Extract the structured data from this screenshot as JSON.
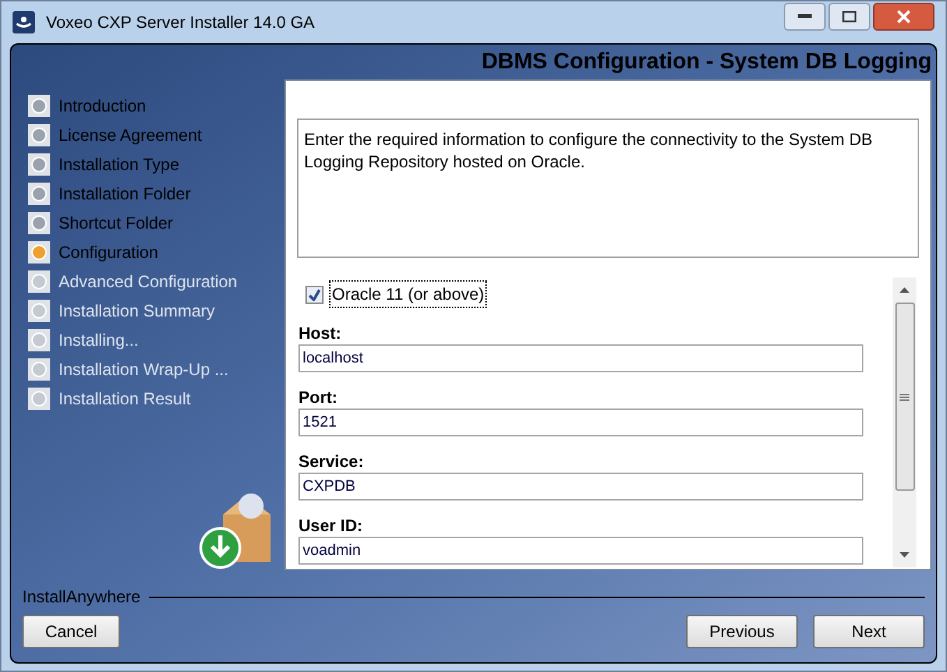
{
  "window": {
    "title": "Voxeo CXP Server Installer 14.0 GA"
  },
  "header": {
    "title": "DBMS Configuration - System DB Logging"
  },
  "steps": [
    {
      "label": "Introduction",
      "selected": false,
      "disabled": false
    },
    {
      "label": "License Agreement",
      "selected": false,
      "disabled": false
    },
    {
      "label": "Installation Type",
      "selected": false,
      "disabled": false
    },
    {
      "label": "Installation Folder",
      "selected": false,
      "disabled": false
    },
    {
      "label": "Shortcut Folder",
      "selected": false,
      "disabled": false
    },
    {
      "label": "Configuration",
      "selected": true,
      "disabled": false
    },
    {
      "label": "Advanced Configuration",
      "selected": false,
      "disabled": true
    },
    {
      "label": "Installation Summary",
      "selected": false,
      "disabled": true
    },
    {
      "label": "Installing...",
      "selected": false,
      "disabled": true
    },
    {
      "label": "Installation Wrap-Up ...",
      "selected": false,
      "disabled": true
    },
    {
      "label": "Installation Result",
      "selected": false,
      "disabled": true
    }
  ],
  "description": "Enter the required information to configure the connectivity to the System DB Logging Repository hosted on Oracle.",
  "oracle_checkbox": {
    "label": "Oracle 11 (or above)",
    "checked": true
  },
  "fields": [
    {
      "label": "Host:",
      "value": "localhost"
    },
    {
      "label": "Port:",
      "value": "1521"
    },
    {
      "label": "Service:",
      "value": "CXPDB"
    },
    {
      "label": "User ID:",
      "value": "voadmin"
    }
  ],
  "brand": "InstallAnywhere",
  "buttons": {
    "cancel": "Cancel",
    "previous": "Previous",
    "next": "Next"
  }
}
